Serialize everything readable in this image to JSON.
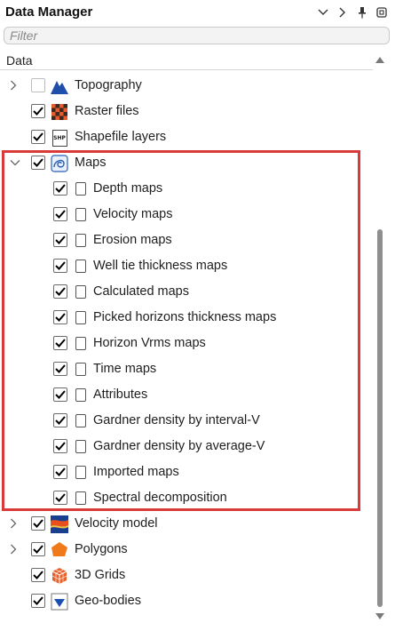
{
  "panel": {
    "title": "Data Manager",
    "filter_placeholder": "Filter",
    "column_header": "Data"
  },
  "tree": {
    "topography": {
      "label": "Topography",
      "checked": false,
      "icon": "topography-mountain-icon"
    },
    "raster_files": {
      "label": "Raster files",
      "checked": true,
      "icon": "raster-grid-icon"
    },
    "shapefile_layers": {
      "label": "Shapefile layers",
      "checked": true,
      "icon": "shp-file-icon",
      "icon_text": "SHP"
    },
    "maps": {
      "label": "Maps",
      "checked": true,
      "expanded": true,
      "icon": "maps-contour-icon",
      "children": [
        {
          "label": "Depth maps",
          "checked": true
        },
        {
          "label": "Velocity maps",
          "checked": true
        },
        {
          "label": "Erosion maps",
          "checked": true
        },
        {
          "label": "Well tie thickness maps",
          "checked": true
        },
        {
          "label": "Calculated maps",
          "checked": true
        },
        {
          "label": "Picked horizons thickness maps",
          "checked": true
        },
        {
          "label": "Horizon Vrms maps",
          "checked": true
        },
        {
          "label": "Time maps",
          "checked": true
        },
        {
          "label": "Attributes",
          "checked": true
        },
        {
          "label": "Gardner density by interval-V",
          "checked": true
        },
        {
          "label": "Gardner density by average-V",
          "checked": true
        },
        {
          "label": "Imported maps",
          "checked": true
        },
        {
          "label": "Spectral decomposition",
          "checked": true
        }
      ]
    },
    "velocity_model": {
      "label": "Velocity model",
      "checked": true,
      "icon": "velocity-model-icon"
    },
    "polygons": {
      "label": "Polygons",
      "checked": true,
      "icon": "polygon-icon"
    },
    "grids_3d": {
      "label": "3D Grids",
      "checked": true,
      "icon": "cube-grid-icon"
    },
    "geo_bodies": {
      "label": "Geo-bodies",
      "checked": true,
      "icon": "geo-body-icon"
    }
  },
  "colors": {
    "highlight_border": "#d93a3a",
    "topography_blue": "#1f4fa8",
    "polygon_orange": "#f07a1a",
    "geobody_blue": "#1a4fb5"
  }
}
